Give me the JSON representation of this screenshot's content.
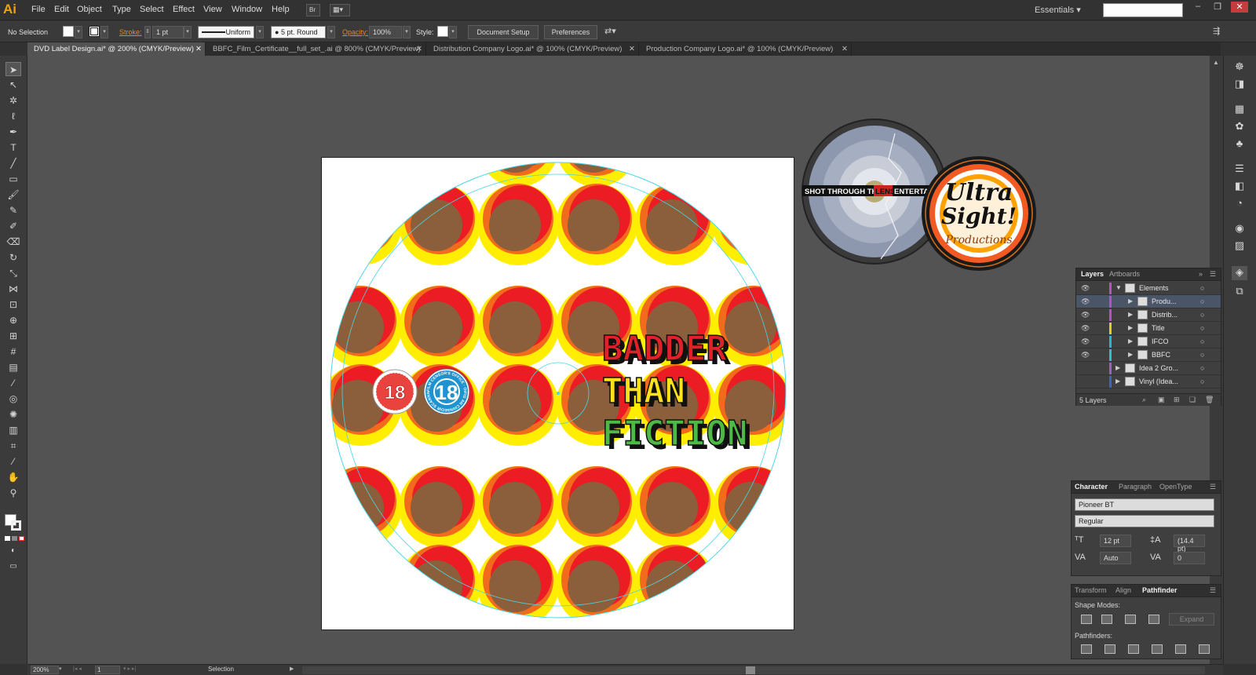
{
  "app": {
    "logo": "Ai",
    "workspace": "Essentials"
  },
  "menu": [
    "File",
    "Edit",
    "Object",
    "Type",
    "Select",
    "Effect",
    "View",
    "Window",
    "Help"
  ],
  "control": {
    "selection": "No Selection",
    "stroke_label": "Stroke:",
    "stroke_weight": "1 pt",
    "profile": "Uniform",
    "brush": "5 pt. Round",
    "opacity_label": "Opacity:",
    "opacity": "100%",
    "style_label": "Style:",
    "doc_setup": "Document Setup",
    "preferences": "Preferences"
  },
  "tabs": [
    {
      "label": "DVD Label Design.ai* @ 200% (CMYK/Preview)",
      "active": true
    },
    {
      "label": "BBFC_Film_Certificate__full_set_.ai @ 800% (CMYK/Preview)"
    },
    {
      "label": "Distribution Company Logo.ai* @ 100% (CMYK/Preview)"
    },
    {
      "label": "Production Company Logo.ai* @ 100% (CMYK/Preview)"
    }
  ],
  "art": {
    "title1": "BADDER",
    "title2": "THAN",
    "title3": "FICTION",
    "rating": "18",
    "ifco_ring": "FILM CENSOR'S OFFICE · OIFIG AN CHINSEOIR SCANNAN",
    "dist_logo_a": "SHOT THROUGH THE",
    "dist_logo_b": "LENS",
    "dist_logo_c": "ENTERTAI",
    "prod_logo_a": "Ultra",
    "prod_logo_b": "Sight!",
    "prod_logo_c": "Productions",
    "colors": {
      "yellow": "#ffee00",
      "orange": "#f26a1b",
      "red": "#ec1c24",
      "brown": "#8b5e3c"
    }
  },
  "layers_panel": {
    "tabs": [
      "Layers",
      "Artboards"
    ],
    "rows": [
      {
        "name": "Elements",
        "level": 0,
        "color": "#c24dc2"
      },
      {
        "name": "Produ...",
        "level": 1,
        "color": "#c24dc2",
        "selected": true
      },
      {
        "name": "Distrib...",
        "level": 1,
        "color": "#c24dc2"
      },
      {
        "name": "Title",
        "level": 1,
        "color": "#e0d020"
      },
      {
        "name": "IFCO",
        "level": 1,
        "color": "#30b0e0"
      },
      {
        "name": "BBFC",
        "level": 1,
        "color": "#30c0c0"
      },
      {
        "name": "Idea 2 Gro...",
        "level": 0,
        "color": "#9a60d0"
      },
      {
        "name": "Vinyl (Idea...",
        "level": 0,
        "color": "#4060d0"
      }
    ],
    "footer": "5 Layers"
  },
  "character_panel": {
    "tabs": [
      "Character",
      "Paragraph",
      "OpenType"
    ],
    "font": "Pioneer BT",
    "style": "Regular",
    "size": "12 pt",
    "leading": "(14.4 pt)",
    "kerning": "Auto",
    "tracking": "0"
  },
  "pathfinder_panel": {
    "tabs": [
      "Transform",
      "Align",
      "Pathfinder"
    ],
    "shape_modes": "Shape Modes:",
    "expand": "Expand",
    "pathfinders": "Pathfinders:"
  },
  "status": {
    "zoom": "200%",
    "page": "1",
    "tool": "Selection"
  }
}
